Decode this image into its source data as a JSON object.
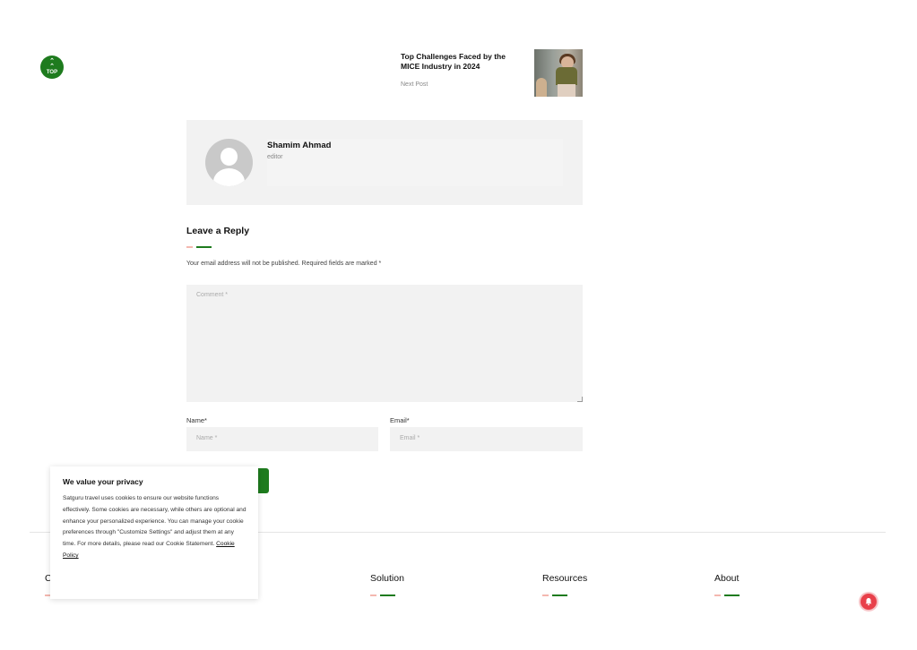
{
  "back_to_top": {
    "label": "TOP",
    "icon": "chevron-double-up-icon"
  },
  "next_post": {
    "title": "Top Challenges Faced by the MICE Industry in 2024",
    "label": "Next Post"
  },
  "author": {
    "name": "Shamim Ahmad",
    "role": "editor"
  },
  "reply": {
    "title": "Leave a Reply",
    "note": "Your email address will not be published. Required fields are marked *",
    "comment_placeholder": "Comment *",
    "name_label": "Name*",
    "name_placeholder": "Name *",
    "email_label": "Email*",
    "email_placeholder": "Email *"
  },
  "privacy": {
    "title": "We value your privacy",
    "text": "Satguru travel uses cookies to ensure our website functions effectively. Some cookies are necessary, while others are optional and enhance your personalized experience. You can manage your cookie preferences through \"Customize Settings\" and adjust them at any time. For more details, please read our Cookie Statement.",
    "link": "Cookie Policy"
  },
  "footer": {
    "partial_heading": "C",
    "headings": [
      "Solution",
      "Resources",
      "About"
    ]
  },
  "colors": {
    "accent": "#1e7b1e",
    "accent_light": "#f4b8b0",
    "bell": "#e8404a"
  }
}
